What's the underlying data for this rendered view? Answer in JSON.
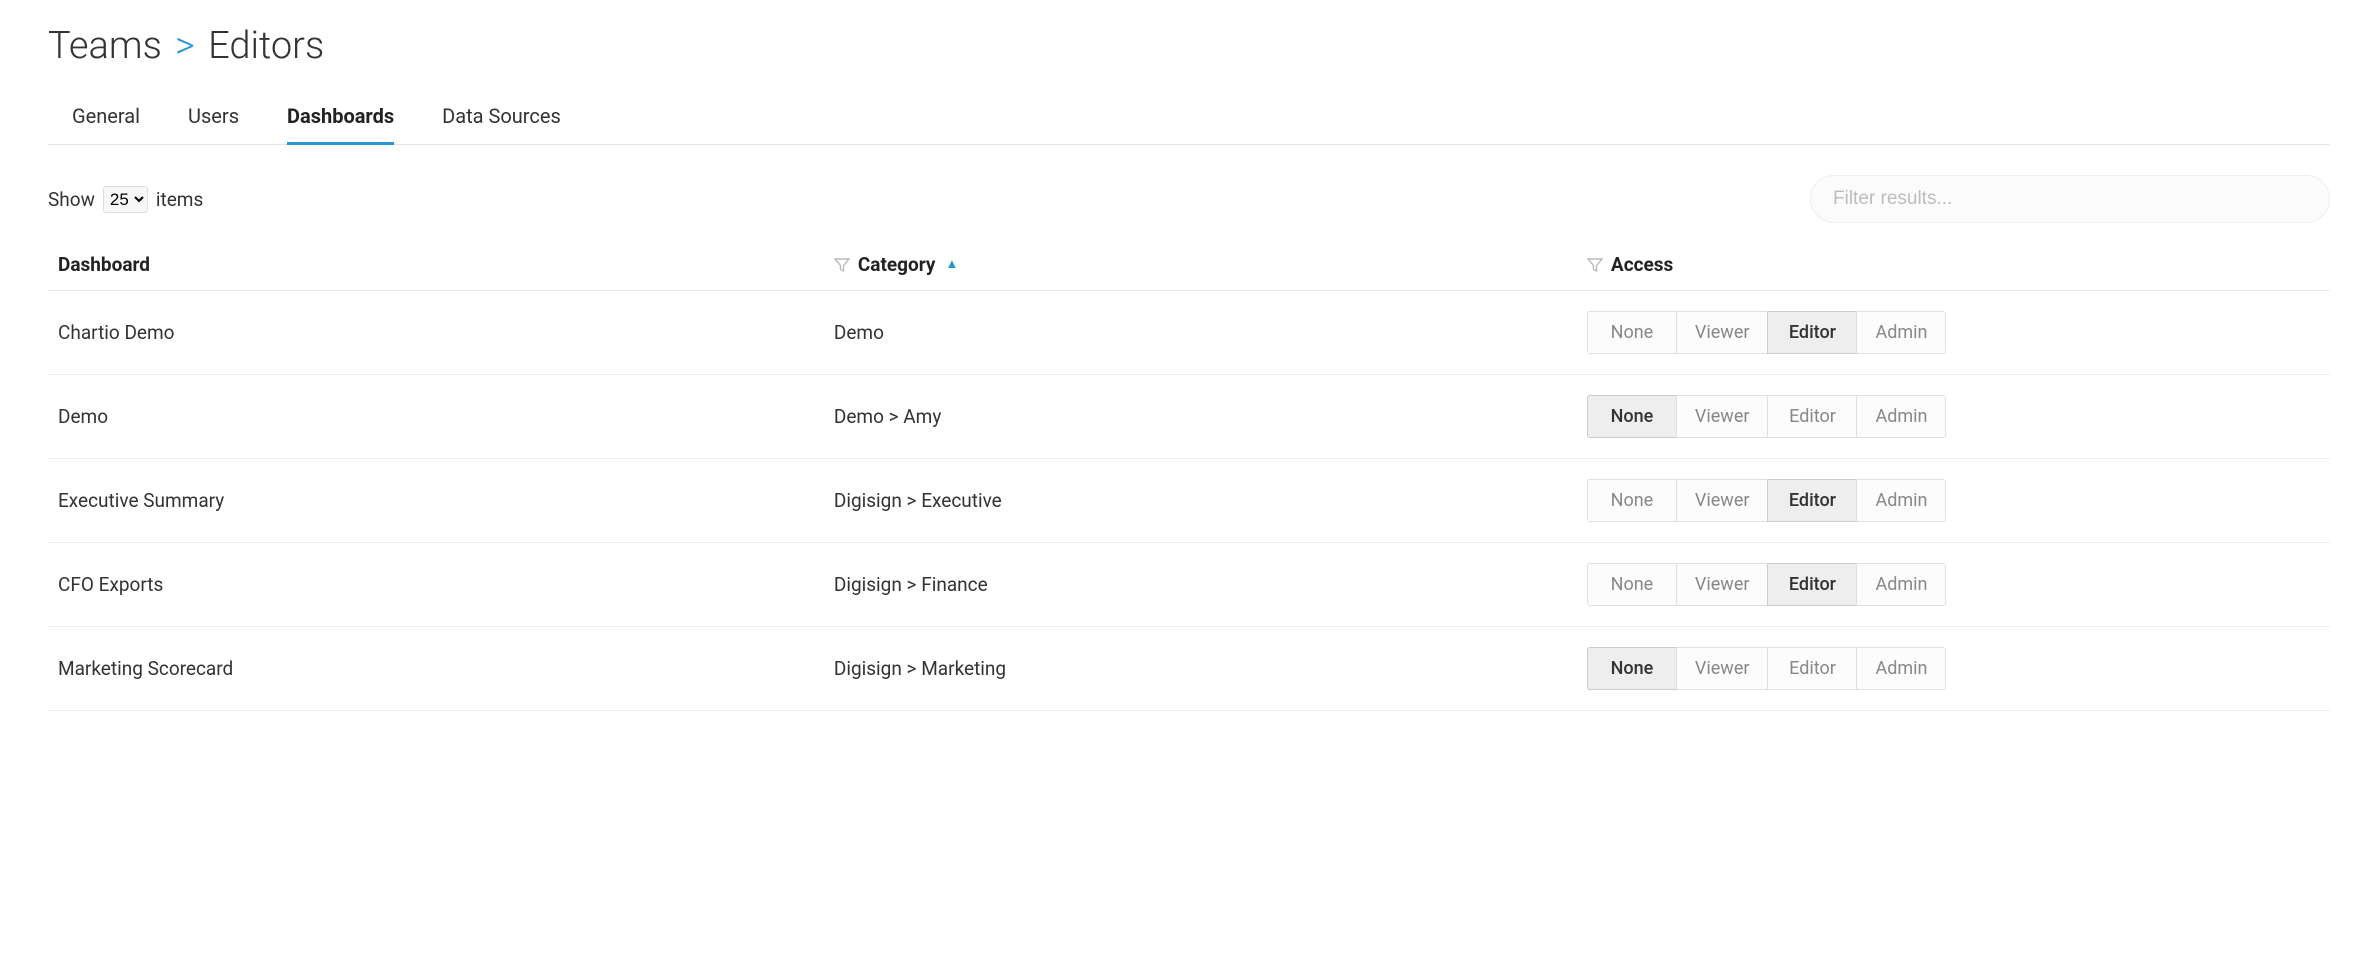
{
  "breadcrumb": {
    "parent": "Teams",
    "separator": ">",
    "current": "Editors"
  },
  "tabs": {
    "general": "General",
    "users": "Users",
    "dashboards": "Dashboards",
    "data_sources": "Data Sources",
    "active": "dashboards"
  },
  "controls": {
    "show_label_prefix": "Show",
    "show_value": "25",
    "show_label_suffix": "items",
    "filter_placeholder": "Filter results..."
  },
  "columns": {
    "dashboard": "Dashboard",
    "category": "Category",
    "access": "Access"
  },
  "access_labels": {
    "none": "None",
    "viewer": "Viewer",
    "editor": "Editor",
    "admin": "Admin"
  },
  "rows": [
    {
      "dashboard": "Chartio Demo",
      "category": "Demo",
      "access": "editor"
    },
    {
      "dashboard": "Demo",
      "category": "Demo > Amy",
      "access": "none"
    },
    {
      "dashboard": "Executive Summary",
      "category": "Digisign > Executive",
      "access": "editor"
    },
    {
      "dashboard": "CFO Exports",
      "category": "Digisign > Finance",
      "access": "editor"
    },
    {
      "dashboard": "Marketing Scorecard",
      "category": "Digisign > Marketing",
      "access": "none"
    }
  ]
}
